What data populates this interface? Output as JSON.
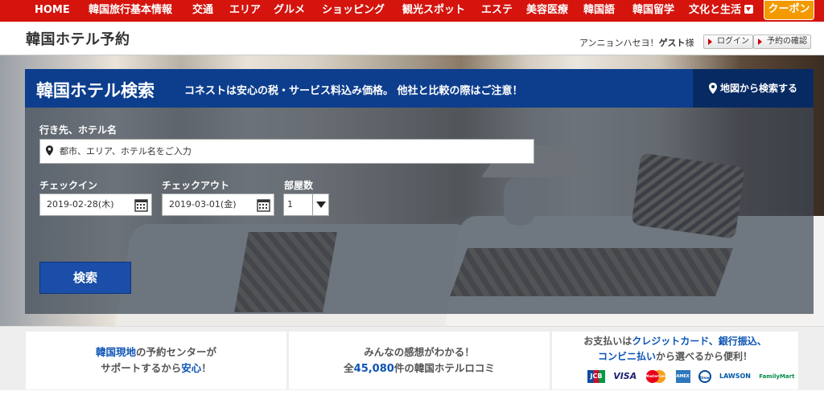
{
  "nav": {
    "items": [
      "HOME",
      "韓国旅行基本情報",
      "交通",
      "エリア",
      "グルメ",
      "ショッピング",
      "観光スポット",
      "エステ",
      "美容医療",
      "韓国語",
      "韓国留学",
      "文化と生活"
    ],
    "coupon": "クーポン"
  },
  "header": {
    "site_title": "韓国ホテル予約",
    "greeting_prefix": "アンニョンハセヨ！",
    "greeting_user": "ゲスト",
    "greeting_suffix": "様",
    "login": "ログイン",
    "booking_check": "予約の確認"
  },
  "search": {
    "title": "韓国ホテル検索",
    "subtitle": "コネストは安心の税・サービス料込み価格。 他社と比較の際はご注意！",
    "map_button": "地図から検索する",
    "dest_label": "行き先、ホテル名",
    "dest_placeholder": "都市、エリア、ホテル名をご入力",
    "checkin_label": "チェックイン",
    "checkin_value": "2019-02-28(木)",
    "checkout_label": "チェックアウト",
    "checkout_value": "2019-03-01(金)",
    "rooms_label": "部屋数",
    "rooms_value": "1",
    "submit": "検索"
  },
  "features": {
    "f1_a": "韓国現地",
    "f1_b": "の予約センターが",
    "f1_c": "サポートするから",
    "f1_d": "安心",
    "f1_e": "！",
    "f2_a": "みんなの感想がわかる！",
    "f2_b": "全",
    "f2_c": "45,080",
    "f2_d": "件の韓国ホテルロコミ",
    "f3_a": "お支払いは",
    "f3_b": "クレジットカード、銀行振込、",
    "f3_c": "コンビニ払い",
    "f3_d": "から選べるから便利！",
    "cards": [
      "JCB",
      "VISA",
      "MasterCard",
      "AMEX",
      "Diners",
      "LAWSON",
      "FamilyMart"
    ]
  },
  "colors": {
    "nav_red": "#d4140d",
    "coupon": "#f39a00",
    "panel_blue": "#0d3e8d",
    "feature_blue": "#0d54b5"
  }
}
